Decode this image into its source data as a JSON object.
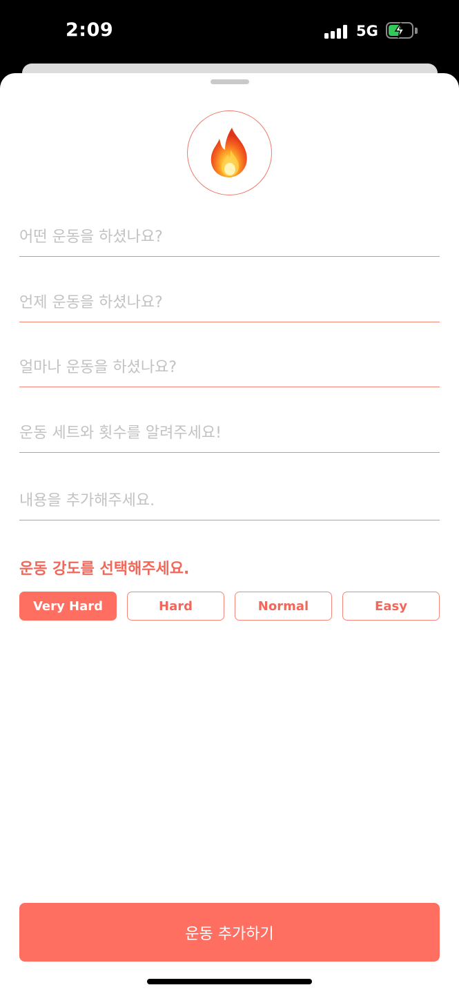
{
  "status_bar": {
    "time": "2:09",
    "network": "5G",
    "icons": [
      "signal-icon",
      "battery-charging-icon"
    ]
  },
  "header": {
    "icon": "fire-icon",
    "accent_color": "#ff6f61"
  },
  "form": {
    "fields": [
      {
        "placeholder": "어떤 운동을 하셨나요?",
        "value": ""
      },
      {
        "placeholder": "언제 운동을 하셨나요?",
        "value": ""
      },
      {
        "placeholder": "얼마나 운동을 하셨나요?",
        "value": ""
      },
      {
        "placeholder": "운동 세트와 횟수를 알려주세요!",
        "value": ""
      },
      {
        "placeholder": "내용을 추가해주세요.",
        "value": ""
      }
    ],
    "intensity_label": "운동 강도를 선택해주세요.",
    "intensity_options": [
      "Very Hard",
      "Hard",
      "Normal",
      "Easy"
    ],
    "selected_intensity": "Very Hard"
  },
  "submit_label": "운동 추가하기"
}
